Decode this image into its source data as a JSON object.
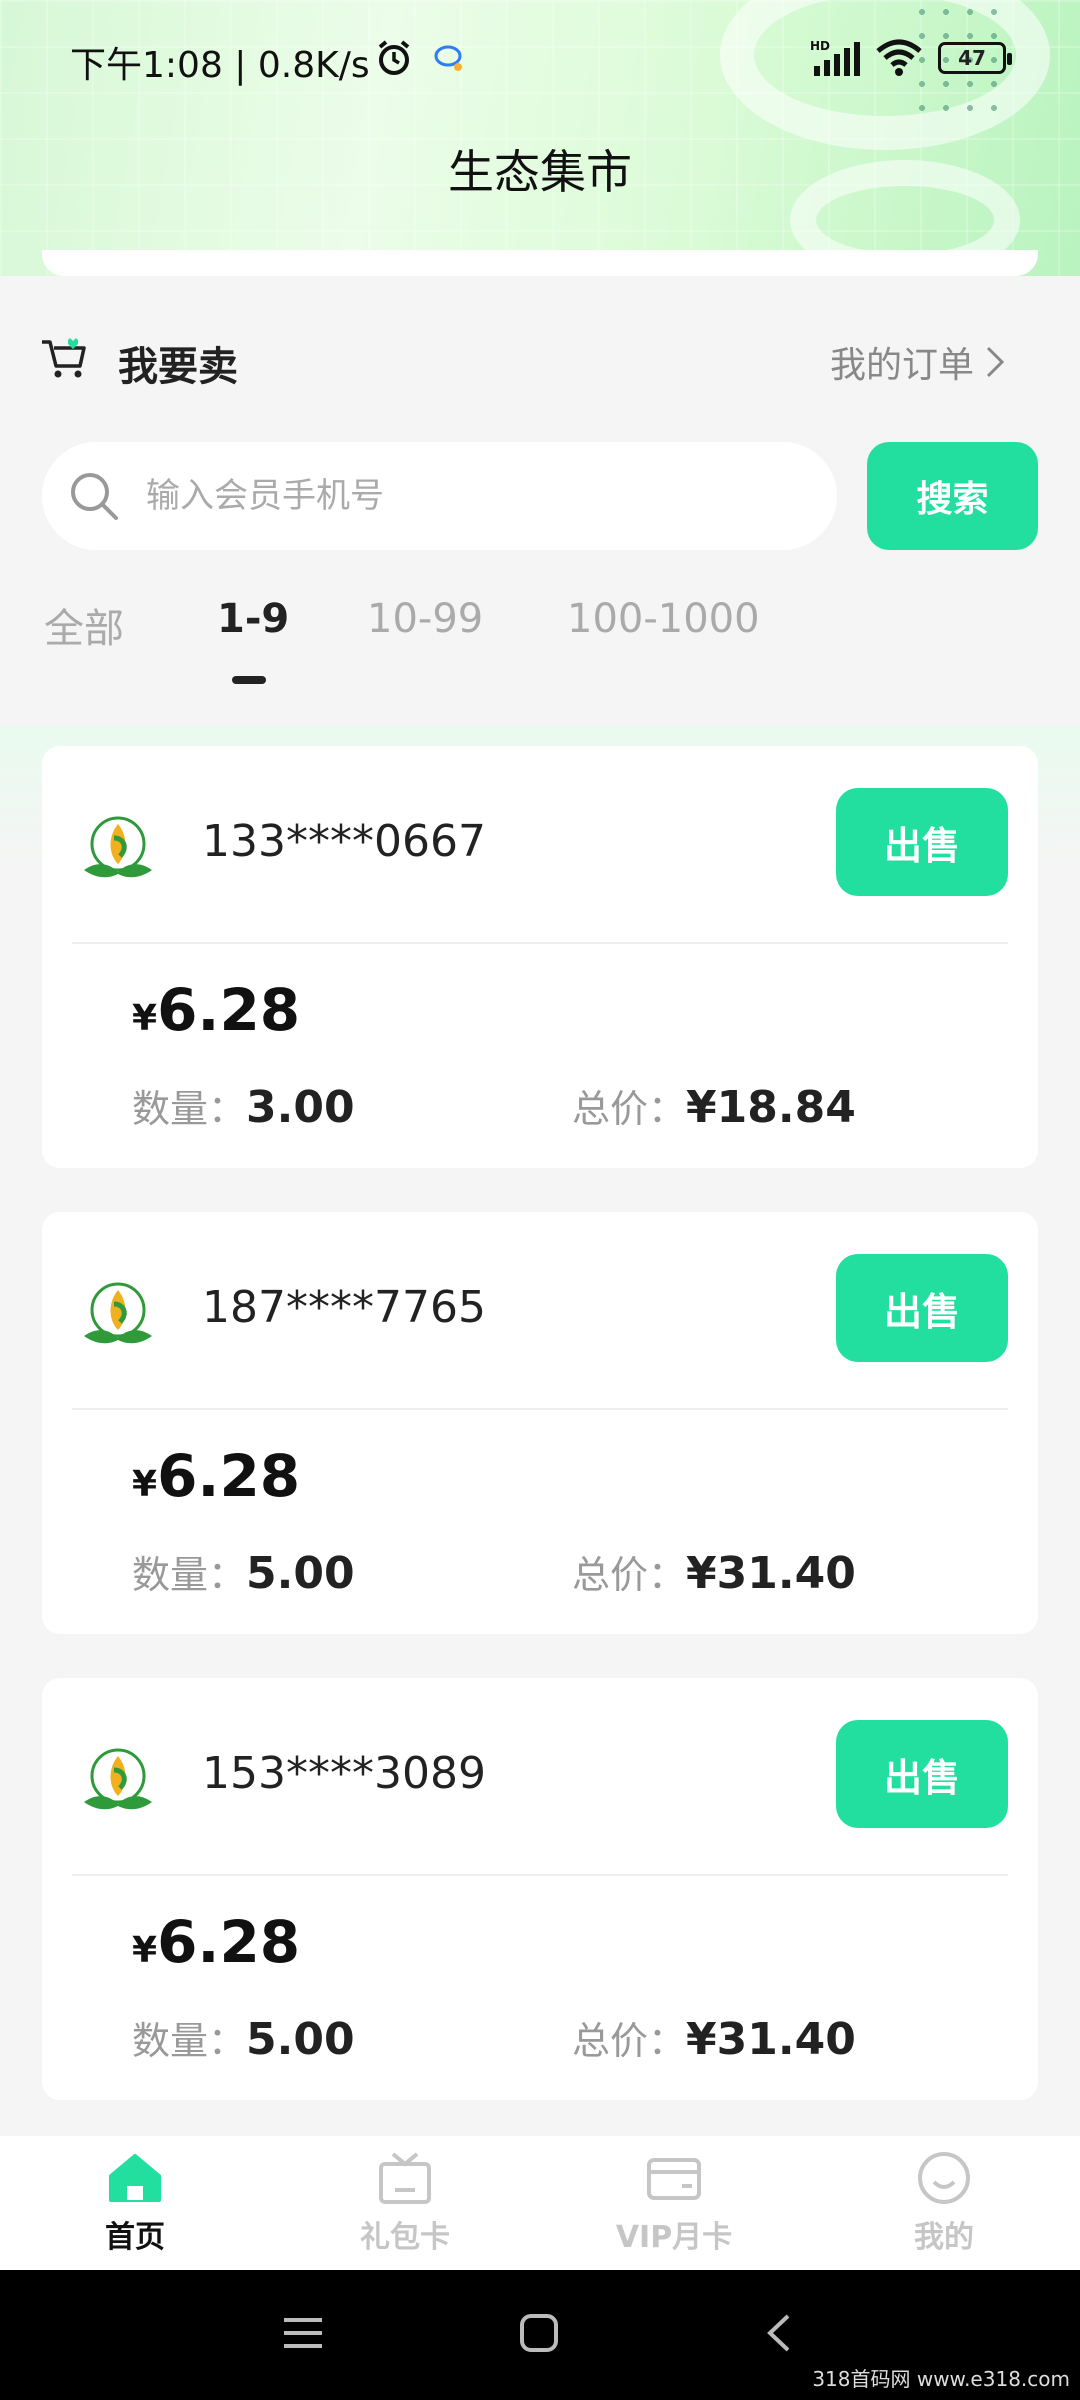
{
  "status_bar": {
    "time": "下午1:08 | 0.8K/s",
    "battery": "47",
    "signal_label": "HD"
  },
  "page": {
    "title": "生态集市"
  },
  "sell": {
    "title": "我要卖",
    "my_orders": "我的订单"
  },
  "search": {
    "placeholder": "输入会员手机号",
    "value": "",
    "button": "搜索"
  },
  "tabs": [
    {
      "label": "全部",
      "active": false
    },
    {
      "label": "1-9",
      "active": true
    },
    {
      "label": "10-99",
      "active": false
    },
    {
      "label": "100-1000",
      "active": false
    }
  ],
  "orders": [
    {
      "phone": "133****0667",
      "price": "6.28",
      "qty_label": "数量：",
      "qty": "3.00",
      "total_label": "总价：",
      "total": "¥18.84",
      "button": "出售"
    },
    {
      "phone": "187****7765",
      "price": "6.28",
      "qty_label": "数量：",
      "qty": "5.00",
      "total_label": "总价：",
      "total": "¥31.40",
      "button": "出售"
    },
    {
      "phone": "153****3089",
      "price": "6.28",
      "qty_label": "数量：",
      "qty": "5.00",
      "total_label": "总价：",
      "total": "¥31.40",
      "button": "出售"
    }
  ],
  "currency_symbol": "¥",
  "nav": [
    {
      "label": "首页",
      "icon": "home-icon",
      "active": true
    },
    {
      "label": "礼包卡",
      "icon": "gift-card-icon",
      "active": false
    },
    {
      "label": "VIP月卡",
      "icon": "vip-card-icon",
      "active": false
    },
    {
      "label": "我的",
      "icon": "profile-icon",
      "active": false
    }
  ],
  "watermark": "318首码网 www.e318.com",
  "colors": {
    "accent": "#22df9f",
    "text": "#222222",
    "muted": "#999999"
  }
}
